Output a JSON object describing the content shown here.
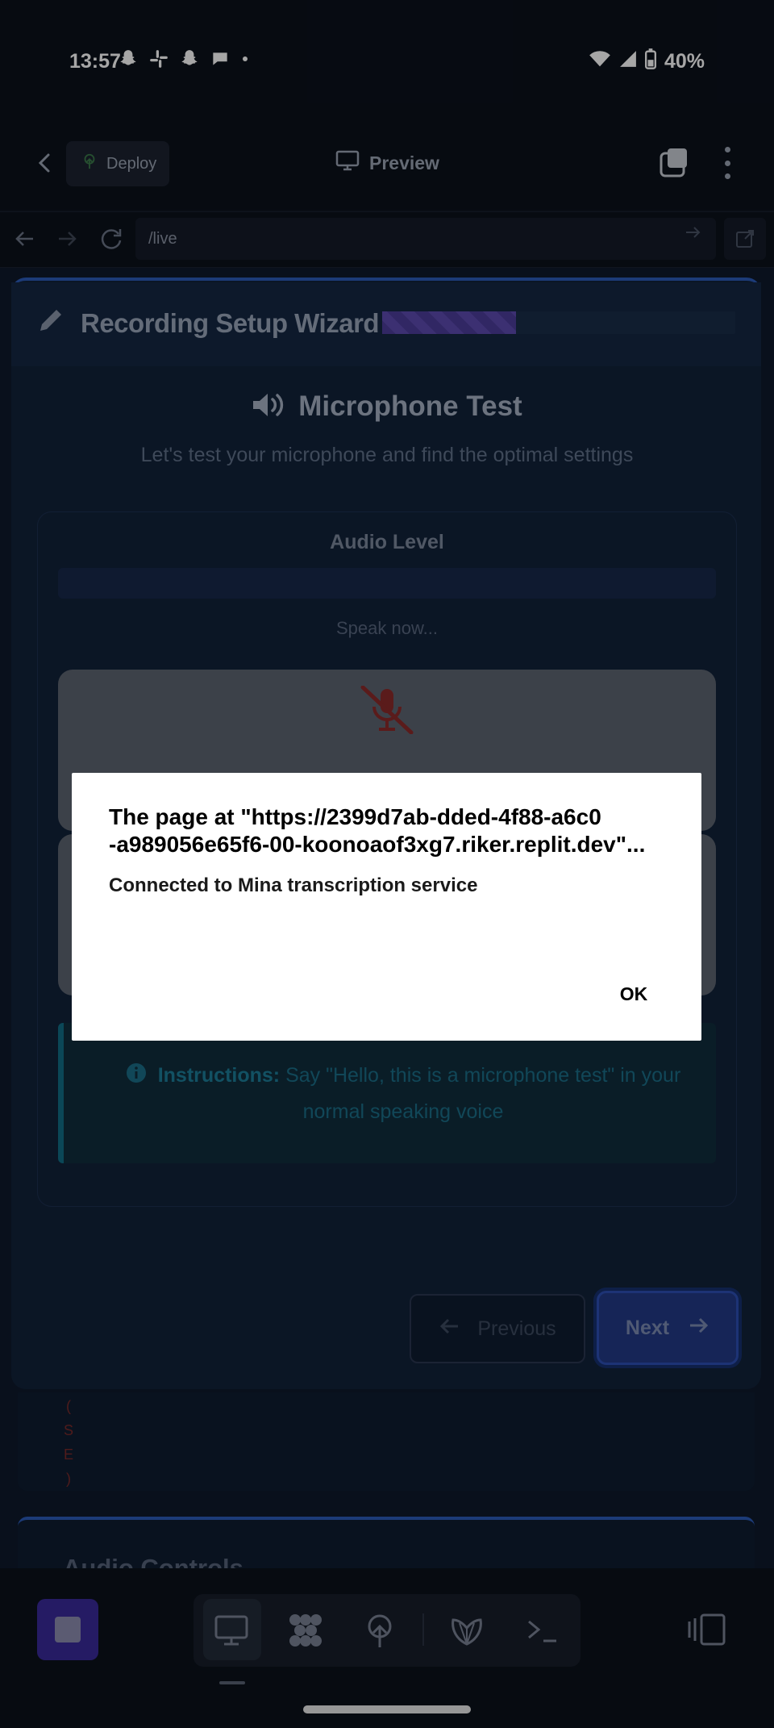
{
  "status_bar": {
    "time": "13:57",
    "battery": "40%",
    "icons": [
      "snapchat-icon",
      "slack-icon",
      "snapchat-icon",
      "messaging-icon",
      "dot-icon",
      "wifi-icon",
      "signal-icon",
      "battery-icon"
    ]
  },
  "header": {
    "deploy_label": "Deploy",
    "preview_label": "Preview"
  },
  "urlbar": {
    "url": "/live"
  },
  "wizard": {
    "title": "Recording Setup Wizard",
    "progress": 0.38,
    "step_title": "Microphone Test",
    "step_subtitle": "Let's test your microphone and find the optimal settings",
    "audio_level_label": "Audio Level",
    "speak_now": "Speak now...",
    "instructions_label": "Instructions:",
    "instructions_text": "Say \"Hello, this is a microphone test\" in your normal speaking voice",
    "prev_label": "Previous",
    "next_label": "Next"
  },
  "background_section": {
    "vertical_letters": [
      "(",
      "S",
      "E",
      ")"
    ],
    "audio_controls_title": "Audio Controls"
  },
  "dialog": {
    "title_line1": "The page at \"https://2399d7ab-dded-4f88-a6c0",
    "title_line2": "-a989056e65f6-00-koonoaof3xg7.riker.replit.dev\"...",
    "message": "Connected to Mina transcription service",
    "ok_label": "OK"
  },
  "colors": {
    "accent": "#2b5bb8",
    "stop_button": "#3a2a9a",
    "instructions_accent": "#116d86"
  }
}
